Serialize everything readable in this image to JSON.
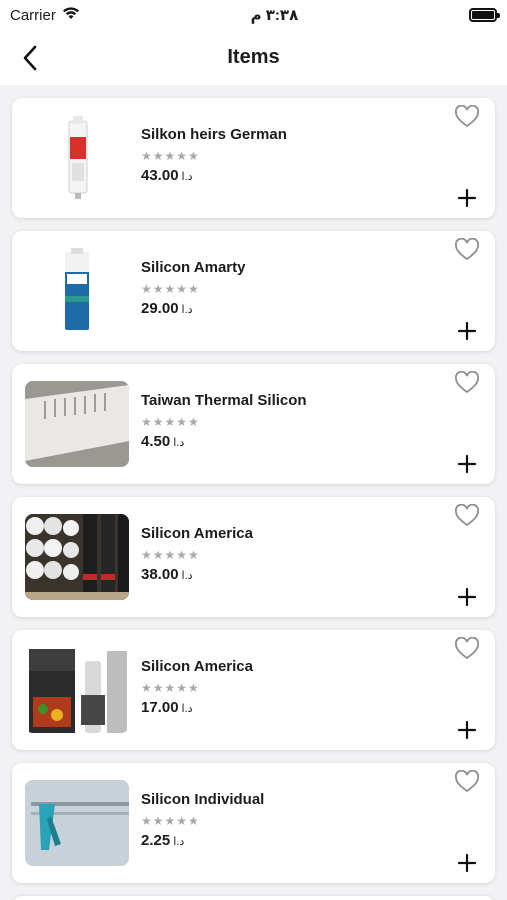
{
  "status": {
    "carrier": "Carrier",
    "time": "٣:٣٨ م"
  },
  "nav": {
    "title": "Items"
  },
  "items": [
    {
      "name": "Silkon heirs German",
      "stars": "★★★★★",
      "price": "43.00",
      "currency": "د.ا",
      "image": "silicone-tube-red"
    },
    {
      "name": "Silicon Amarty",
      "stars": "★★★★★",
      "price": "29.00",
      "currency": "د.ا",
      "image": "silicone-tube-blue"
    },
    {
      "name": "Taiwan Thermal Silicon",
      "stars": "★★★★★",
      "price": "4.50",
      "currency": "د.ا",
      "image": "thermal-pad"
    },
    {
      "name": "Silicon America",
      "stars": "★★★★★",
      "price": "38.00",
      "currency": "د.ا",
      "image": "silicone-tubes-box"
    },
    {
      "name": "Silicon America",
      "stars": "★★★★★",
      "price": "17.00",
      "currency": "د.ا",
      "image": "gasket-maker"
    },
    {
      "name": "Silicon Individual",
      "stars": "★★★★★",
      "price": "2.25",
      "currency": "د.ا",
      "image": "caulking-gun"
    }
  ]
}
